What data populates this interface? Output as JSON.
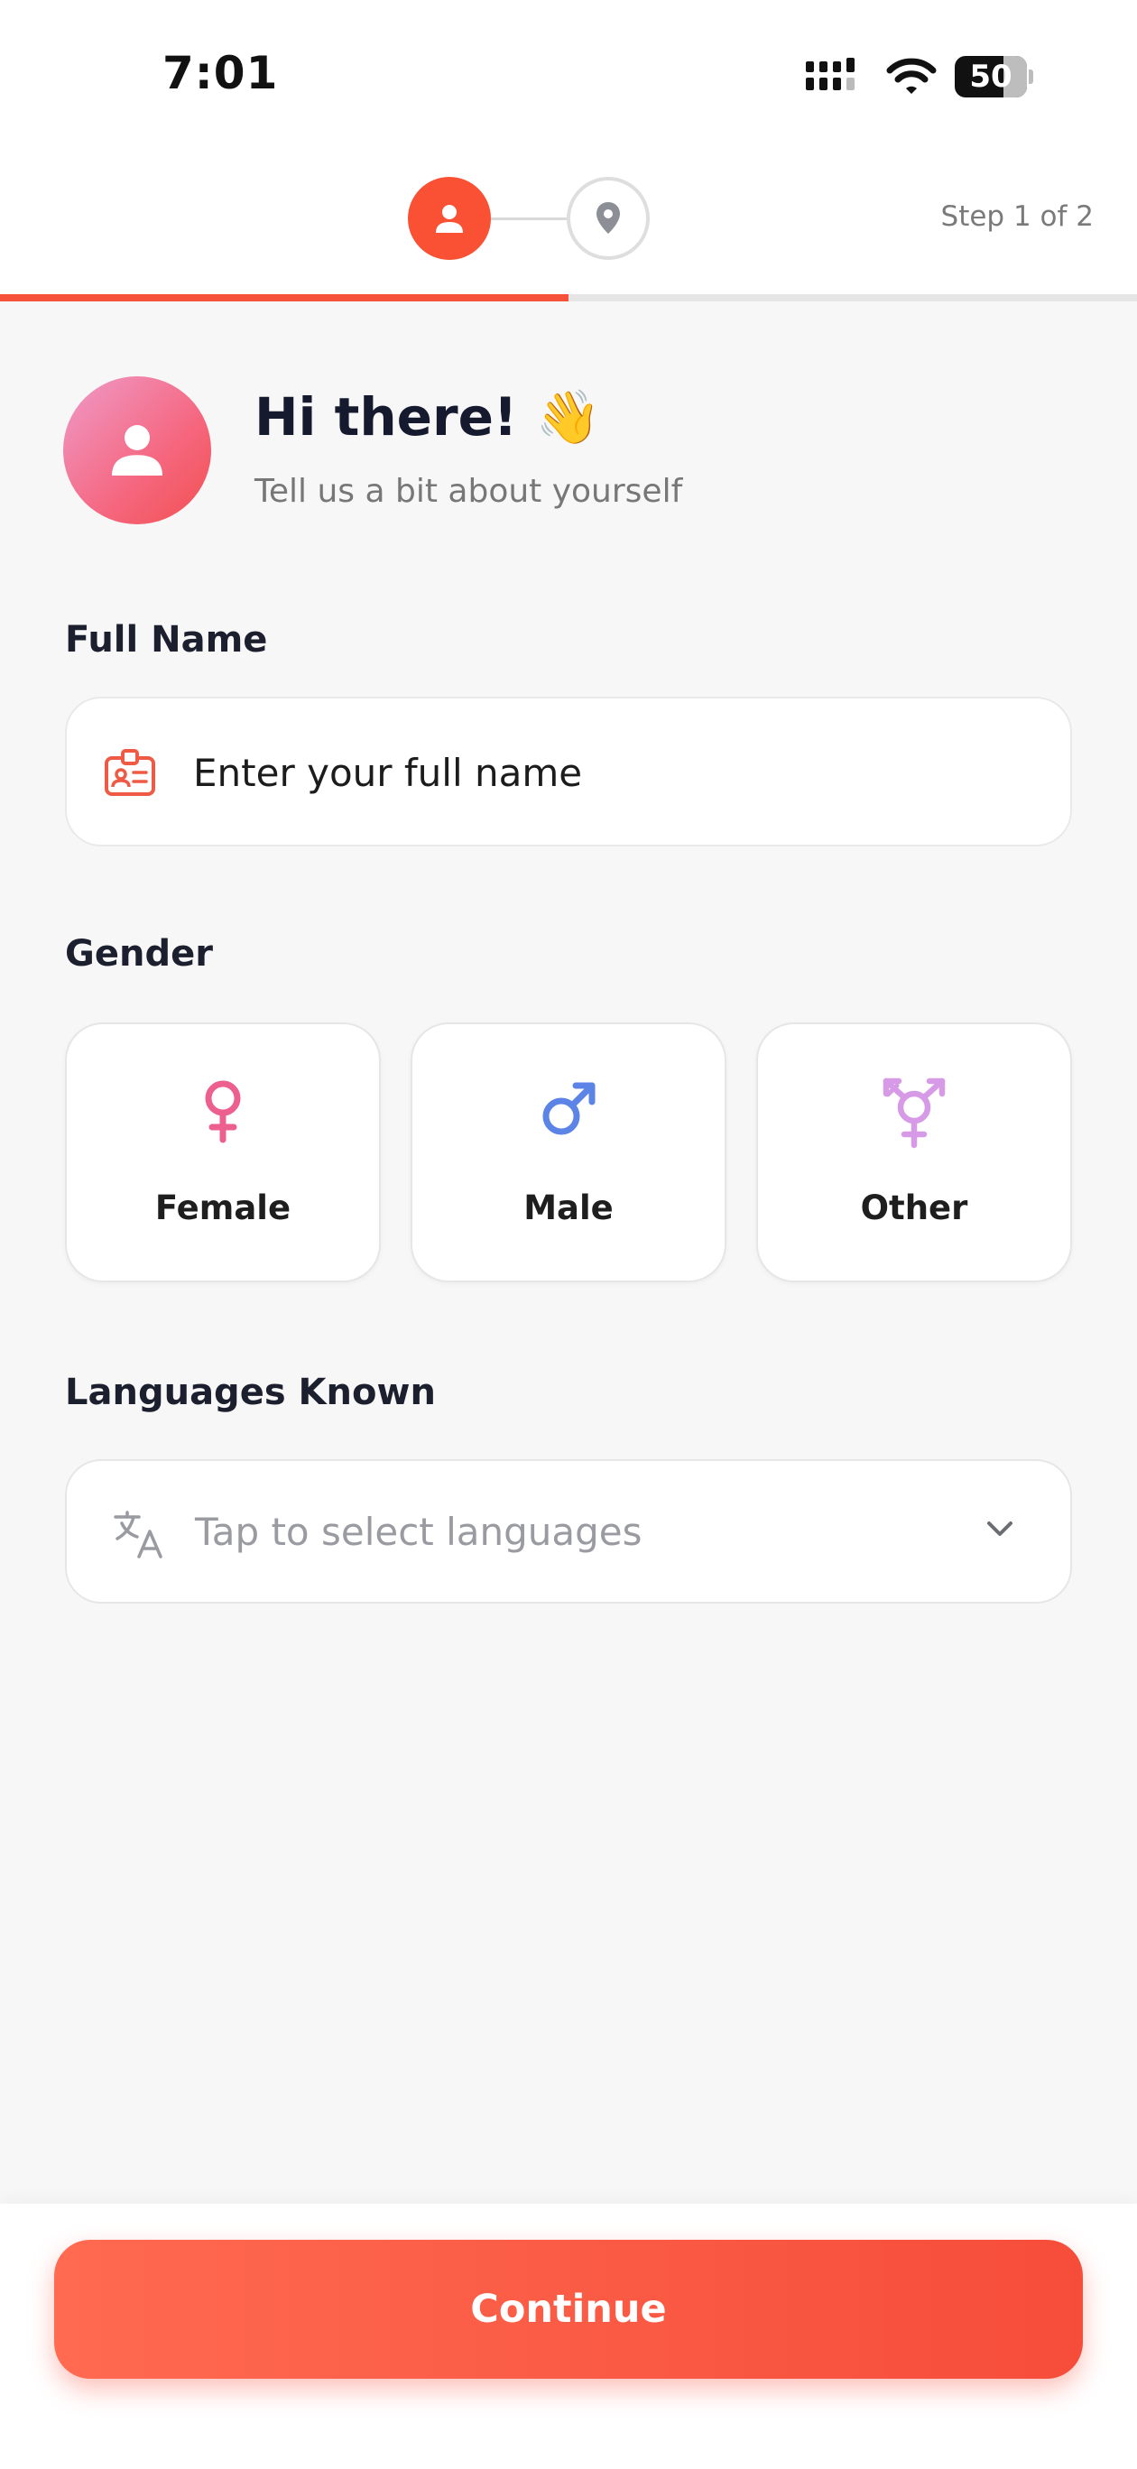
{
  "status_bar": {
    "time": "7:01",
    "battery": "50"
  },
  "stepper": {
    "step_label": "Step 1 of 2",
    "progress_fraction": 0.5
  },
  "greeting": {
    "title": "Hi there! 👋",
    "subtitle": "Tell us a bit about yourself"
  },
  "full_name": {
    "label": "Full Name",
    "placeholder": "Enter your full name",
    "value": ""
  },
  "gender": {
    "label": "Gender",
    "options": [
      {
        "label": "Female",
        "icon": "female-icon",
        "color": "#ec5f8e"
      },
      {
        "label": "Male",
        "icon": "male-icon",
        "color": "#5b84e6"
      },
      {
        "label": "Other",
        "icon": "transgender-icon",
        "color": "#d79ae6"
      }
    ]
  },
  "languages": {
    "label": "Languages Known",
    "placeholder": "Tap to select languages"
  },
  "continue_button": {
    "label": "Continue"
  },
  "colors": {
    "accent": "#f6513a",
    "text_dark": "#1c1f2e"
  }
}
